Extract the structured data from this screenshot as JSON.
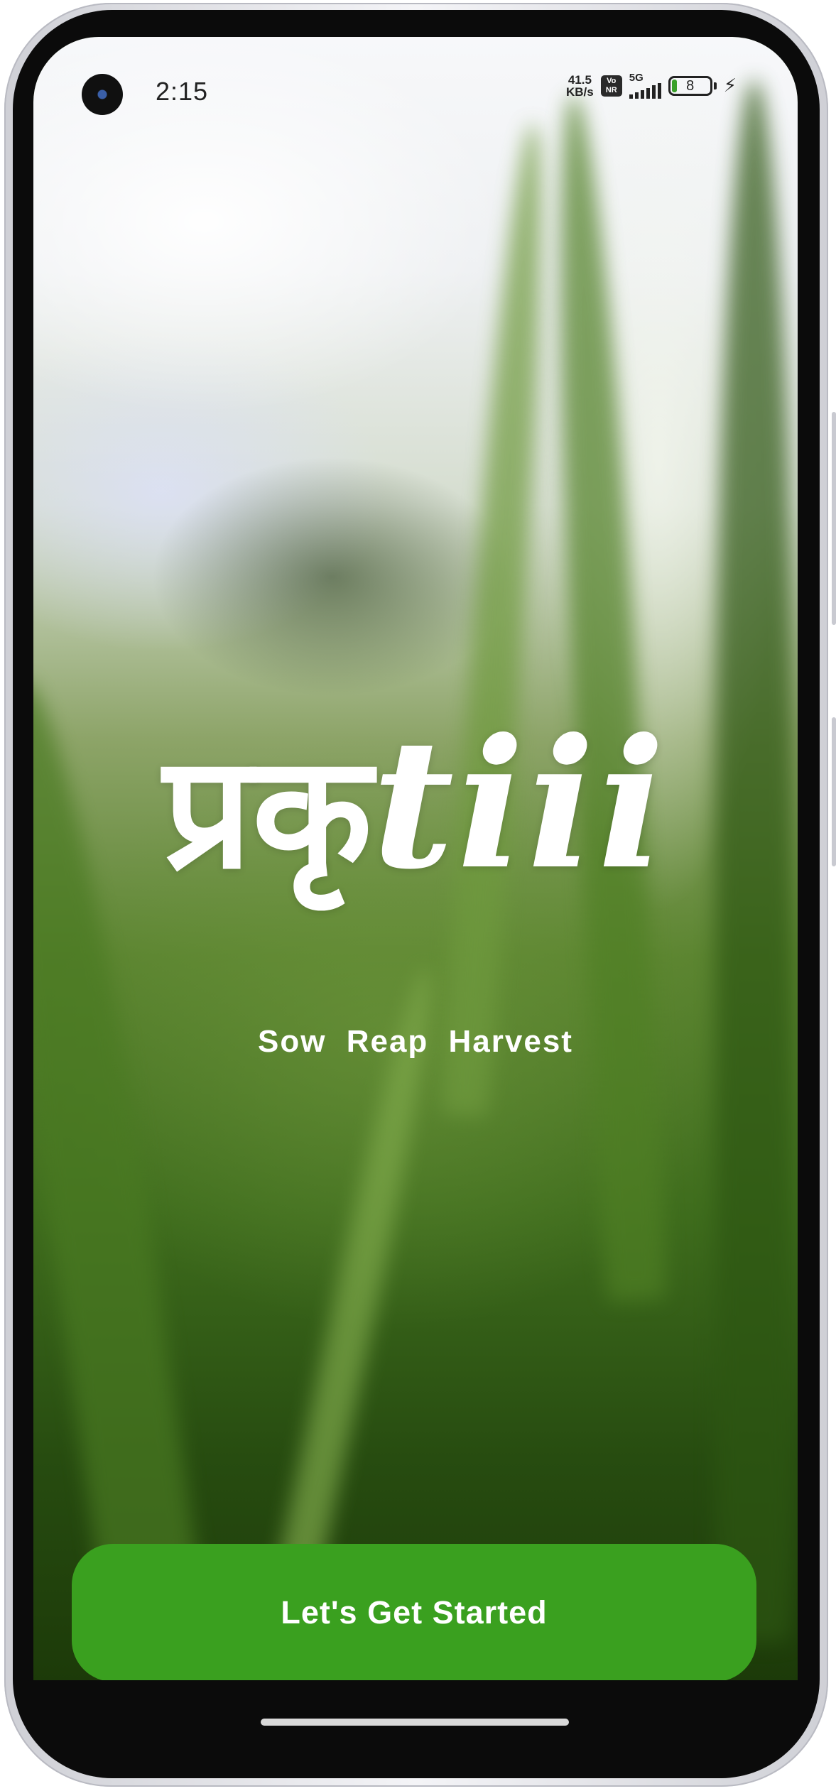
{
  "status_bar": {
    "time": "2:15",
    "net_speed_value": "41.5",
    "net_speed_unit": "KB/s",
    "vonr_top": "Vo",
    "vonr_bottom": "NR",
    "network_type": "5G",
    "battery_level": "8",
    "charging_icon": "lightning-bolt-icon"
  },
  "splash": {
    "logo_devanagari": "प्रकृ",
    "logo_latin": "tiii",
    "tagline": "Sow  Reap  Harvest"
  },
  "actions": {
    "get_started_label": "Let's Get Started"
  },
  "colors": {
    "button_green": "#3aa01f",
    "logo_text": "#ffffff",
    "battery_fill": "#3aa02a"
  }
}
